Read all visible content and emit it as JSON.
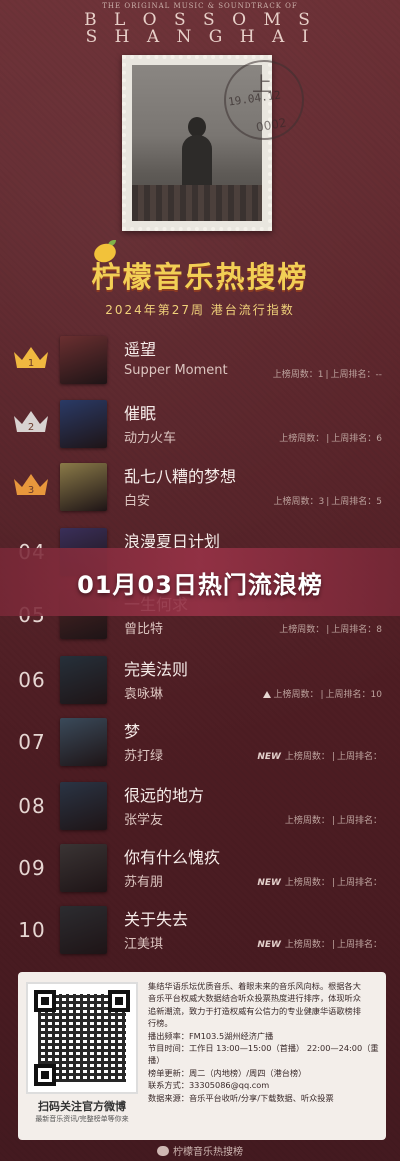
{
  "album": {
    "small_text": "THE ORIGINAL MUSIC & SOUNDTRACK OF",
    "line1": "B L O S S O M S",
    "line2": "S H A N G H A I",
    "postmark_up": "上",
    "postmark_date": "19.04.12",
    "postmark_bottom": "0002"
  },
  "chart": {
    "title": "柠檬音乐热搜榜",
    "subtitle": "2024年第27周 港台流行指数"
  },
  "banner": {
    "text": "01月03日热门流浪榜"
  },
  "labels": {
    "weeks": "上榜周数：",
    "last_rank": "上周排名："
  },
  "songs": [
    {
      "rank": "1",
      "title": "遥望",
      "artist": "Supper Moment",
      "weeks": "1",
      "last": "--",
      "tag": "",
      "cover": "#6a2f30"
    },
    {
      "rank": "2",
      "title": "催眠",
      "artist": "动力火车",
      "weeks": "",
      "last": "6",
      "tag": "",
      "cover": "#2a3a66"
    },
    {
      "rank": "3",
      "title": "乱七八糟的梦想",
      "artist": "白安",
      "weeks": "3",
      "last": "5",
      "tag": "",
      "cover": "#8a7a48"
    },
    {
      "rank": "04",
      "title": "浪漫夏日计划",
      "artist": "",
      "weeks": "",
      "last": "",
      "tag": "",
      "cover": "#3a2f5a"
    },
    {
      "rank": "05",
      "title": "一生何求",
      "artist": "曾比特",
      "weeks": "",
      "last": "8",
      "tag": "",
      "cover": "#4a2424"
    },
    {
      "rank": "06",
      "title": "完美法则",
      "artist": "袁咏琳",
      "weeks": "",
      "last": "10",
      "tag": "up",
      "cover": "#26303a"
    },
    {
      "rank": "07",
      "title": "梦",
      "artist": "苏打绿",
      "weeks": "",
      "last": "",
      "tag": "new",
      "cover": "#3a4a5a"
    },
    {
      "rank": "08",
      "title": "很远的地方",
      "artist": "张学友",
      "weeks": "",
      "last": "",
      "tag": "",
      "cover": "#2a3444"
    },
    {
      "rank": "09",
      "title": "你有什么愧疚",
      "artist": "苏有朋",
      "weeks": "",
      "last": "",
      "tag": "new",
      "cover": "#3a3434"
    },
    {
      "rank": "10",
      "title": "关于失去",
      "artist": "江美琪",
      "weeks": "",
      "last": "",
      "tag": "new",
      "cover": "#2c2c30"
    }
  ],
  "footer": {
    "qr_caption": "扫码关注官方微博",
    "qr_caption2": "最新音乐资讯/完整榜单等你来",
    "info_lines": [
      "集结华语乐坛优质音乐、着眼未来的音乐风向标。根据各大",
      "音乐平台权威大数据结合听众投票热度进行排序，体现听众",
      "追新潮流，致力于打造权威有公信力的专业健康华语歌榜排",
      "行榜。",
      "播出频率：FM103.5湖州经济广播",
      "节目时间：工作日 13:00—15:00（首播） 22:00—24:00（重播）",
      "榜单更新：周二（内地榜）/周四（港台榜）",
      "联系方式：33305086@qq.com",
      "数据来源：音乐平台收听/分享/下载数据、听众投票"
    ],
    "wechat": "柠檬音乐热搜榜"
  }
}
